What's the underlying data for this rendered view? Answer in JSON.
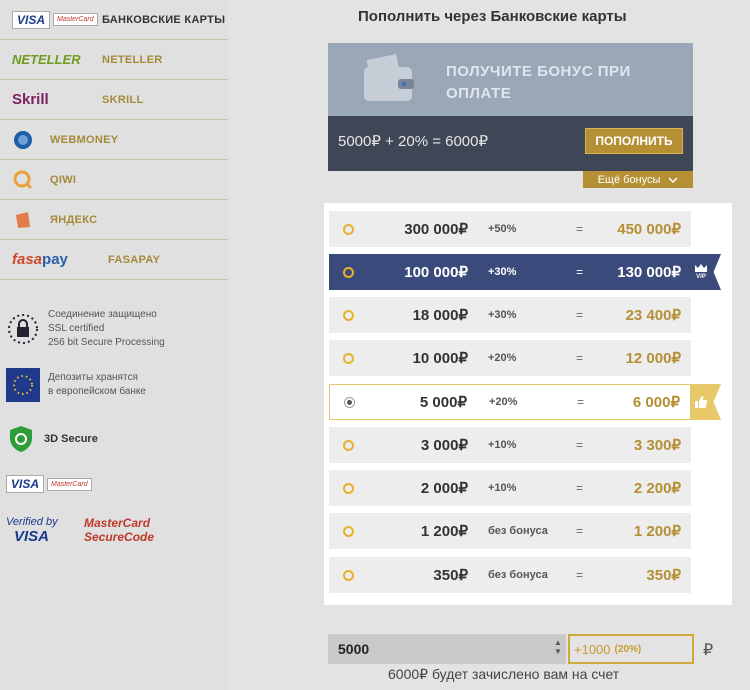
{
  "sidebar": {
    "methods": [
      {
        "logo": "VISA",
        "logo2": "MasterCard",
        "label": "БАНКОВСКИЕ КАРТЫ",
        "active": true
      },
      {
        "logo": "NETELLER",
        "label": "NETELLER"
      },
      {
        "logo": "Skrill",
        "label": "SKRILL"
      },
      {
        "logo": "webmoney-icon",
        "label": "WEBMONEY"
      },
      {
        "logo": "qiwi-icon",
        "label": "QIWI"
      },
      {
        "logo": "yandex-icon",
        "label": "ЯНДЕКС"
      },
      {
        "logo": "fasapay",
        "label": "FASAPAY"
      }
    ],
    "security": {
      "ssl": [
        "Соединение защищено",
        "SSL certified",
        "256 bit Secure Processing"
      ],
      "deposits": [
        "Депозиты хранятся",
        "в европейском банке"
      ],
      "secure3d": "3D Secure",
      "verified_visa_1": "Verified by",
      "verified_visa_2": "VISA",
      "mc_secure_1": "MasterCard",
      "mc_secure_2": "SecureCode"
    }
  },
  "main": {
    "title": "Пополнить через Банковские карты",
    "banner": {
      "headline_1": "ПОЛУЧИТЕ БОНУС ПРИ",
      "headline_2": "ОПЛАТЕ",
      "formula": "5000₽ + 20% = 6000₽",
      "button": "ПОПОЛНИТЬ",
      "more": "Ещё бонусы"
    },
    "options": [
      {
        "amount": "300 000₽",
        "bonus": "+50%",
        "eq": "=",
        "total": "450 000₽"
      },
      {
        "amount": "100 000₽",
        "bonus": "+30%",
        "eq": "=",
        "total": "130 000₽",
        "vip": true
      },
      {
        "amount": "18 000₽",
        "bonus": "+30%",
        "eq": "=",
        "total": "23 400₽"
      },
      {
        "amount": "10 000₽",
        "bonus": "+20%",
        "eq": "=",
        "total": "12 000₽"
      },
      {
        "amount": "5 000₽",
        "bonus": "+20%",
        "eq": "=",
        "total": "6 000₽",
        "selected": true
      },
      {
        "amount": "3 000₽",
        "bonus": "+10%",
        "eq": "=",
        "total": "3 300₽"
      },
      {
        "amount": "2 000₽",
        "bonus": "+10%",
        "eq": "=",
        "total": "2 200₽"
      },
      {
        "amount": "1 200₽",
        "bonus": "без бонуса",
        "eq": "=",
        "total": "1 200₽"
      },
      {
        "amount": "350₽",
        "bonus": "без бонуса",
        "eq": "=",
        "total": "350₽"
      }
    ],
    "vip_label": "VIP",
    "input_value": "5000",
    "bonus_value": "+1000",
    "bonus_pct": "(20%)",
    "currency": "₽",
    "credit_note": "6000₽ будет зачислено вам на счет"
  }
}
